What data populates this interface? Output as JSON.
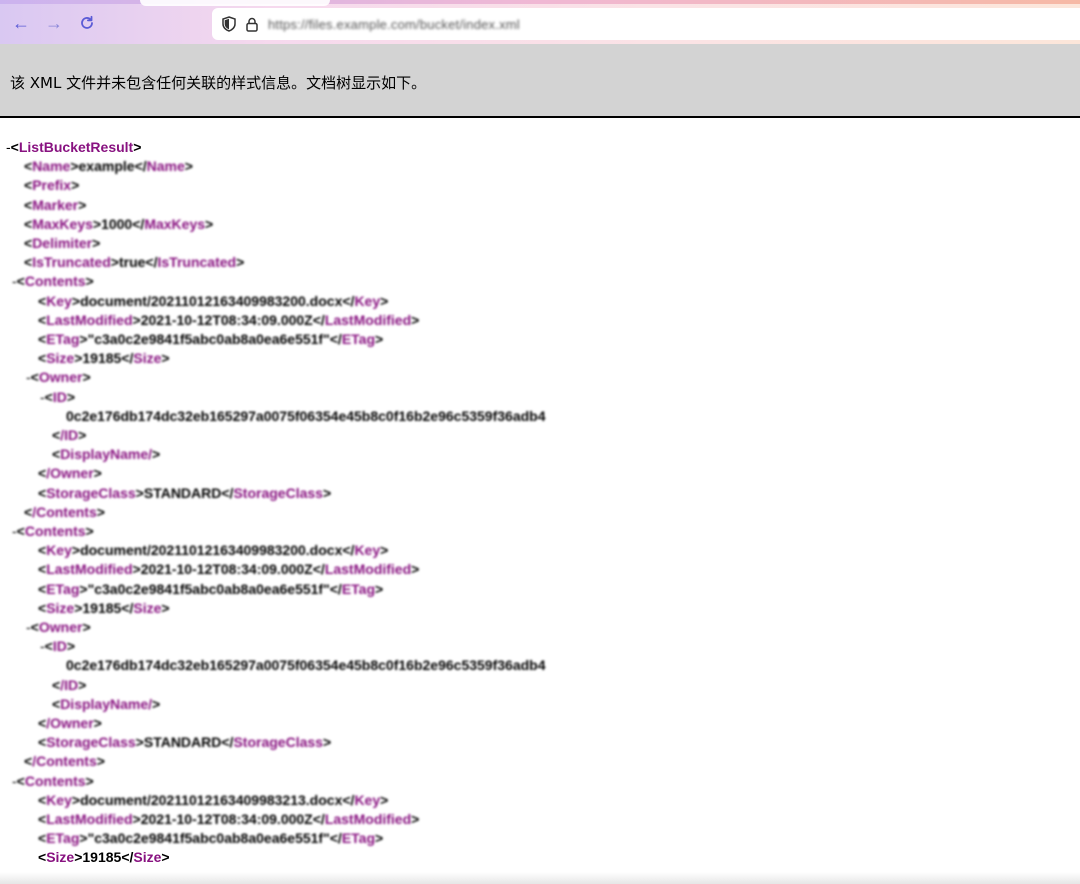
{
  "browser": {
    "url": "https://files.example.com/bucket/index.xml",
    "back_icon": "arrow-left-icon",
    "forward_icon": "arrow-right-icon",
    "reload_icon": "reload-icon",
    "shield_icon": "shield-icon",
    "lock_icon": "lock-icon"
  },
  "banner": {
    "message": "该 XML 文件并未包含任何关联的样式信息。文档树显示如下。"
  },
  "xml": {
    "collapse_symbol": "-",
    "lines": [
      {
        "indent": 0,
        "toggle": true,
        "open": "ListBucketResult",
        "text": "",
        "close": "",
        "blur": false
      },
      {
        "indent": 1,
        "toggle": false,
        "open": "Name",
        "text": "example",
        "close": "Name",
        "blur": true
      },
      {
        "indent": 1,
        "toggle": false,
        "open": "Prefix",
        "text": "",
        "close": "",
        "blur": true
      },
      {
        "indent": 1,
        "toggle": false,
        "open": "Marker",
        "text": "",
        "close": "",
        "blur": true
      },
      {
        "indent": 1,
        "toggle": false,
        "open": "MaxKeys",
        "text": "1000",
        "close": "MaxKeys",
        "blur": true
      },
      {
        "indent": 1,
        "toggle": false,
        "open": "Delimiter",
        "text": "",
        "close": "",
        "blur": true
      },
      {
        "indent": 1,
        "toggle": false,
        "open": "IsTruncated",
        "text": "true",
        "close": "IsTruncated",
        "blur": true
      },
      {
        "indent": 1,
        "toggle": true,
        "open": "Contents",
        "text": "",
        "close": "",
        "blur": true
      },
      {
        "indent": 2,
        "toggle": false,
        "open": "Key",
        "text": "document/20211012163409983200.docx",
        "close": "Key",
        "blur": true
      },
      {
        "indent": 2,
        "toggle": false,
        "open": "LastModified",
        "text": "2021-10-12T08:34:09.000Z",
        "close": "LastModified",
        "blur": true
      },
      {
        "indent": 2,
        "toggle": false,
        "open": "ETag",
        "text": "\"c3a0c2e9841f5abc0ab8a0ea6e551f\"",
        "close": "ETag",
        "blur": true
      },
      {
        "indent": 2,
        "toggle": false,
        "open": "Size",
        "text": "19185",
        "close": "Size",
        "blur": true
      },
      {
        "indent": 2,
        "toggle": true,
        "open": "Owner",
        "text": "",
        "close": "",
        "blur": true
      },
      {
        "indent": 3,
        "toggle": true,
        "open": "ID",
        "text": "",
        "close": "",
        "blur": true
      },
      {
        "indent": 4,
        "toggle": false,
        "open": "",
        "text": "0c2e176db174dc32eb165297a0075f06354e45b8c0f16b2e96c5359f36adb4",
        "close": "",
        "blur": true
      },
      {
        "indent": 3,
        "toggle": false,
        "open": "/ID",
        "text": "",
        "close": "",
        "blur": true
      },
      {
        "indent": 3,
        "toggle": false,
        "open": "DisplayName/",
        "text": "",
        "close": "",
        "blur": true
      },
      {
        "indent": 2,
        "toggle": false,
        "open": "/Owner",
        "text": "",
        "close": "",
        "blur": true
      },
      {
        "indent": 2,
        "toggle": false,
        "open": "StorageClass",
        "text": "STANDARD",
        "close": "StorageClass",
        "blur": true
      },
      {
        "indent": 1,
        "toggle": false,
        "open": "/Contents",
        "text": "",
        "close": "",
        "blur": true
      },
      {
        "indent": 1,
        "toggle": true,
        "open": "Contents",
        "text": "",
        "close": "",
        "blur": true
      },
      {
        "indent": 2,
        "toggle": false,
        "open": "Key",
        "text": "document/20211012163409983200.docx",
        "close": "Key",
        "blur": true
      },
      {
        "indent": 2,
        "toggle": false,
        "open": "LastModified",
        "text": "2021-10-12T08:34:09.000Z",
        "close": "LastModified",
        "blur": true
      },
      {
        "indent": 2,
        "toggle": false,
        "open": "ETag",
        "text": "\"c3a0c2e9841f5abc0ab8a0ea6e551f\"",
        "close": "ETag",
        "blur": true
      },
      {
        "indent": 2,
        "toggle": false,
        "open": "Size",
        "text": "19185",
        "close": "Size",
        "blur": true
      },
      {
        "indent": 2,
        "toggle": true,
        "open": "Owner",
        "text": "",
        "close": "",
        "blur": true
      },
      {
        "indent": 3,
        "toggle": true,
        "open": "ID",
        "text": "",
        "close": "",
        "blur": true
      },
      {
        "indent": 4,
        "toggle": false,
        "open": "",
        "text": "0c2e176db174dc32eb165297a0075f06354e45b8c0f16b2e96c5359f36adb4",
        "close": "",
        "blur": true
      },
      {
        "indent": 3,
        "toggle": false,
        "open": "/ID",
        "text": "",
        "close": "",
        "blur": true
      },
      {
        "indent": 3,
        "toggle": false,
        "open": "DisplayName/",
        "text": "",
        "close": "",
        "blur": true
      },
      {
        "indent": 2,
        "toggle": false,
        "open": "/Owner",
        "text": "",
        "close": "",
        "blur": true
      },
      {
        "indent": 2,
        "toggle": false,
        "open": "StorageClass",
        "text": "STANDARD",
        "close": "StorageClass",
        "blur": true
      },
      {
        "indent": 1,
        "toggle": false,
        "open": "/Contents",
        "text": "",
        "close": "",
        "blur": true
      },
      {
        "indent": 1,
        "toggle": true,
        "open": "Contents",
        "text": "",
        "close": "",
        "blur": true
      },
      {
        "indent": 2,
        "toggle": false,
        "open": "Key",
        "text": "document/20211012163409983213.docx",
        "close": "Key",
        "blur": true
      },
      {
        "indent": 2,
        "toggle": false,
        "open": "LastModified",
        "text": "2021-10-12T08:34:09.000Z",
        "close": "LastModified",
        "blur": true
      },
      {
        "indent": 2,
        "toggle": false,
        "open": "ETag",
        "text": "\"c3a0c2e9841f5abc0ab8a0ea6e551f\"",
        "close": "ETag",
        "blur": true
      },
      {
        "indent": 2,
        "toggle": false,
        "open": "Size",
        "text": "19185",
        "close": "Size",
        "blur": false
      }
    ]
  }
}
